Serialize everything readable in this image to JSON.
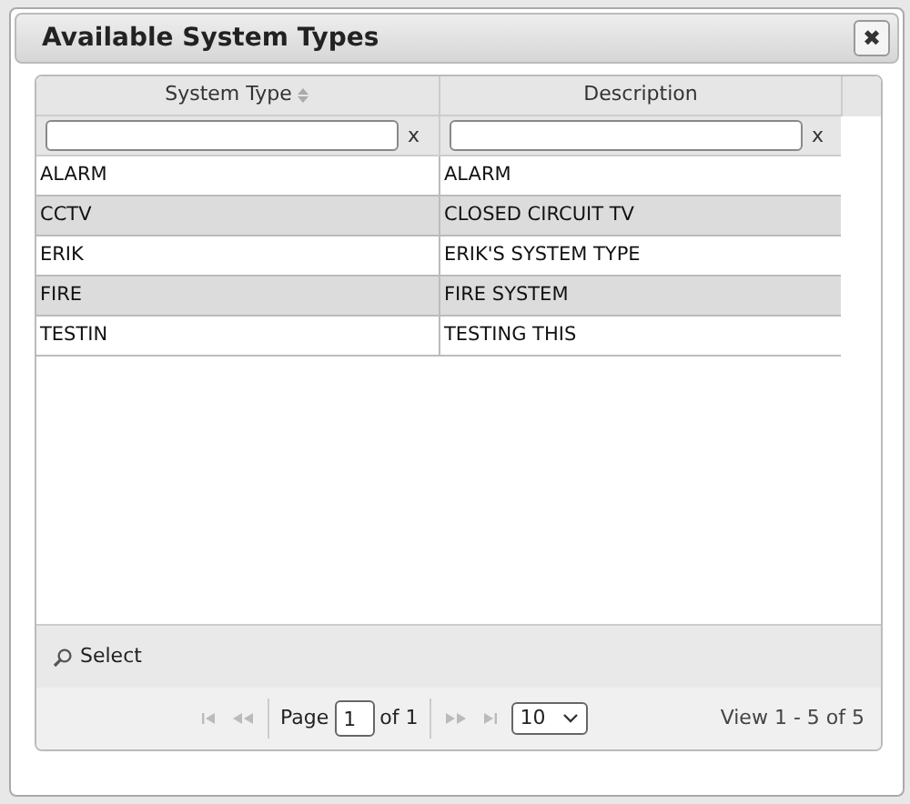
{
  "dialog": {
    "title": "Available System Types",
    "close": "✖"
  },
  "table": {
    "columns": [
      {
        "label": "System Type",
        "sortable": true,
        "filter_clear": "x"
      },
      {
        "label": "Description",
        "sortable": false,
        "filter_clear": "x"
      }
    ],
    "rows": [
      {
        "cells": [
          "ALARM",
          "ALARM"
        ],
        "shaded": false
      },
      {
        "cells": [
          "CCTV",
          "CLOSED CIRCUIT TV"
        ],
        "shaded": true
      },
      {
        "cells": [
          "ERIK",
          "ERIK'S SYSTEM TYPE"
        ],
        "shaded": false
      },
      {
        "cells": [
          "FIRE",
          "FIRE SYSTEM"
        ],
        "shaded": true
      },
      {
        "cells": [
          "TESTIN",
          "TESTING THIS"
        ],
        "shaded": false
      }
    ]
  },
  "toolbar": {
    "select_label": "Select"
  },
  "pager": {
    "page_label": "Page",
    "page": "1",
    "of_label": "of 1",
    "page_size": "10",
    "summary": "View 1 - 5 of 5"
  }
}
